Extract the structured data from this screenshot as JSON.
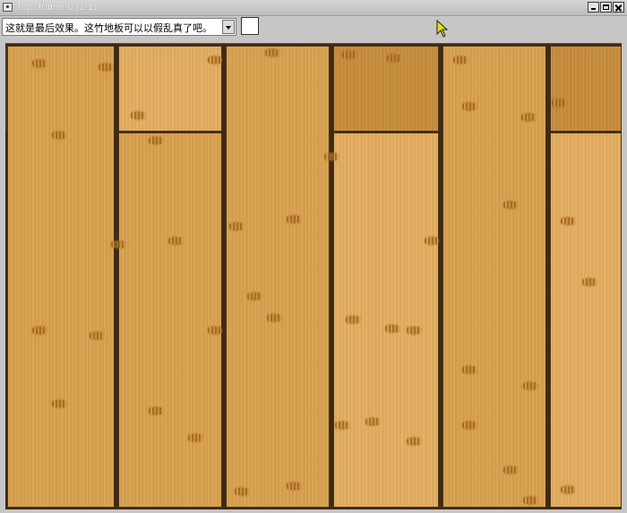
{
  "window": {
    "title": "Top, frame 0 (1:1)",
    "icon": "camera-icon",
    "controls": [
      "minimize-icon",
      "maximize-icon",
      "close-icon"
    ]
  },
  "toolbar": {
    "combo_value": "这就是最后效果。这竹地板可以以假乱真了吧。",
    "color_swatch": "#ffffff"
  },
  "cursor": {
    "icon": "arrow-cursor-icon",
    "color": "#e8e000"
  },
  "render": {
    "gap_color": "#3e2a16",
    "plank_colors": {
      "light": "#e2ae62",
      "mid": "#d7a150",
      "dark": "#c58c3c"
    }
  }
}
